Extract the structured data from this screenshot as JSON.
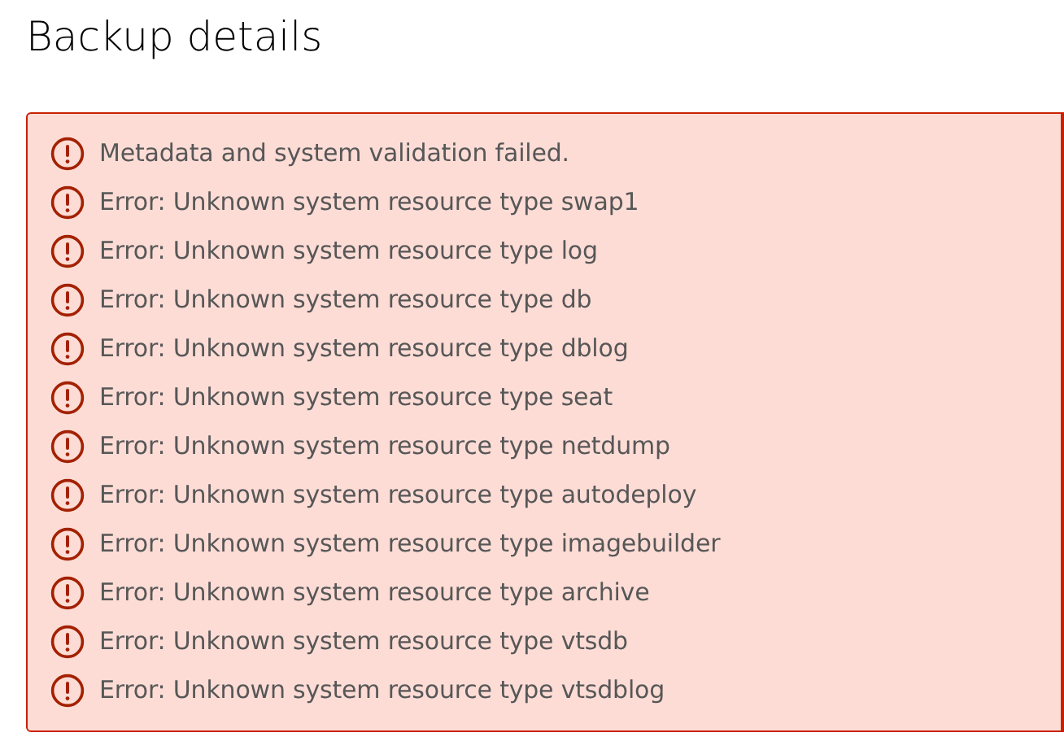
{
  "title": "Backup details",
  "alert": {
    "messages": [
      {
        "text": "Metadata and system validation failed."
      },
      {
        "text": "Error: Unknown system resource type swap1"
      },
      {
        "text": "Error: Unknown system resource type log"
      },
      {
        "text": "Error: Unknown system resource type db"
      },
      {
        "text": "Error: Unknown system resource type dblog"
      },
      {
        "text": "Error: Unknown system resource type seat"
      },
      {
        "text": "Error: Unknown system resource type netdump"
      },
      {
        "text": "Error: Unknown system resource type autodeploy"
      },
      {
        "text": "Error: Unknown system resource type imagebuilder"
      },
      {
        "text": "Error: Unknown system resource type archive"
      },
      {
        "text": "Error: Unknown system resource type vtsdb"
      },
      {
        "text": "Error: Unknown system resource type vtsdblog"
      }
    ]
  }
}
